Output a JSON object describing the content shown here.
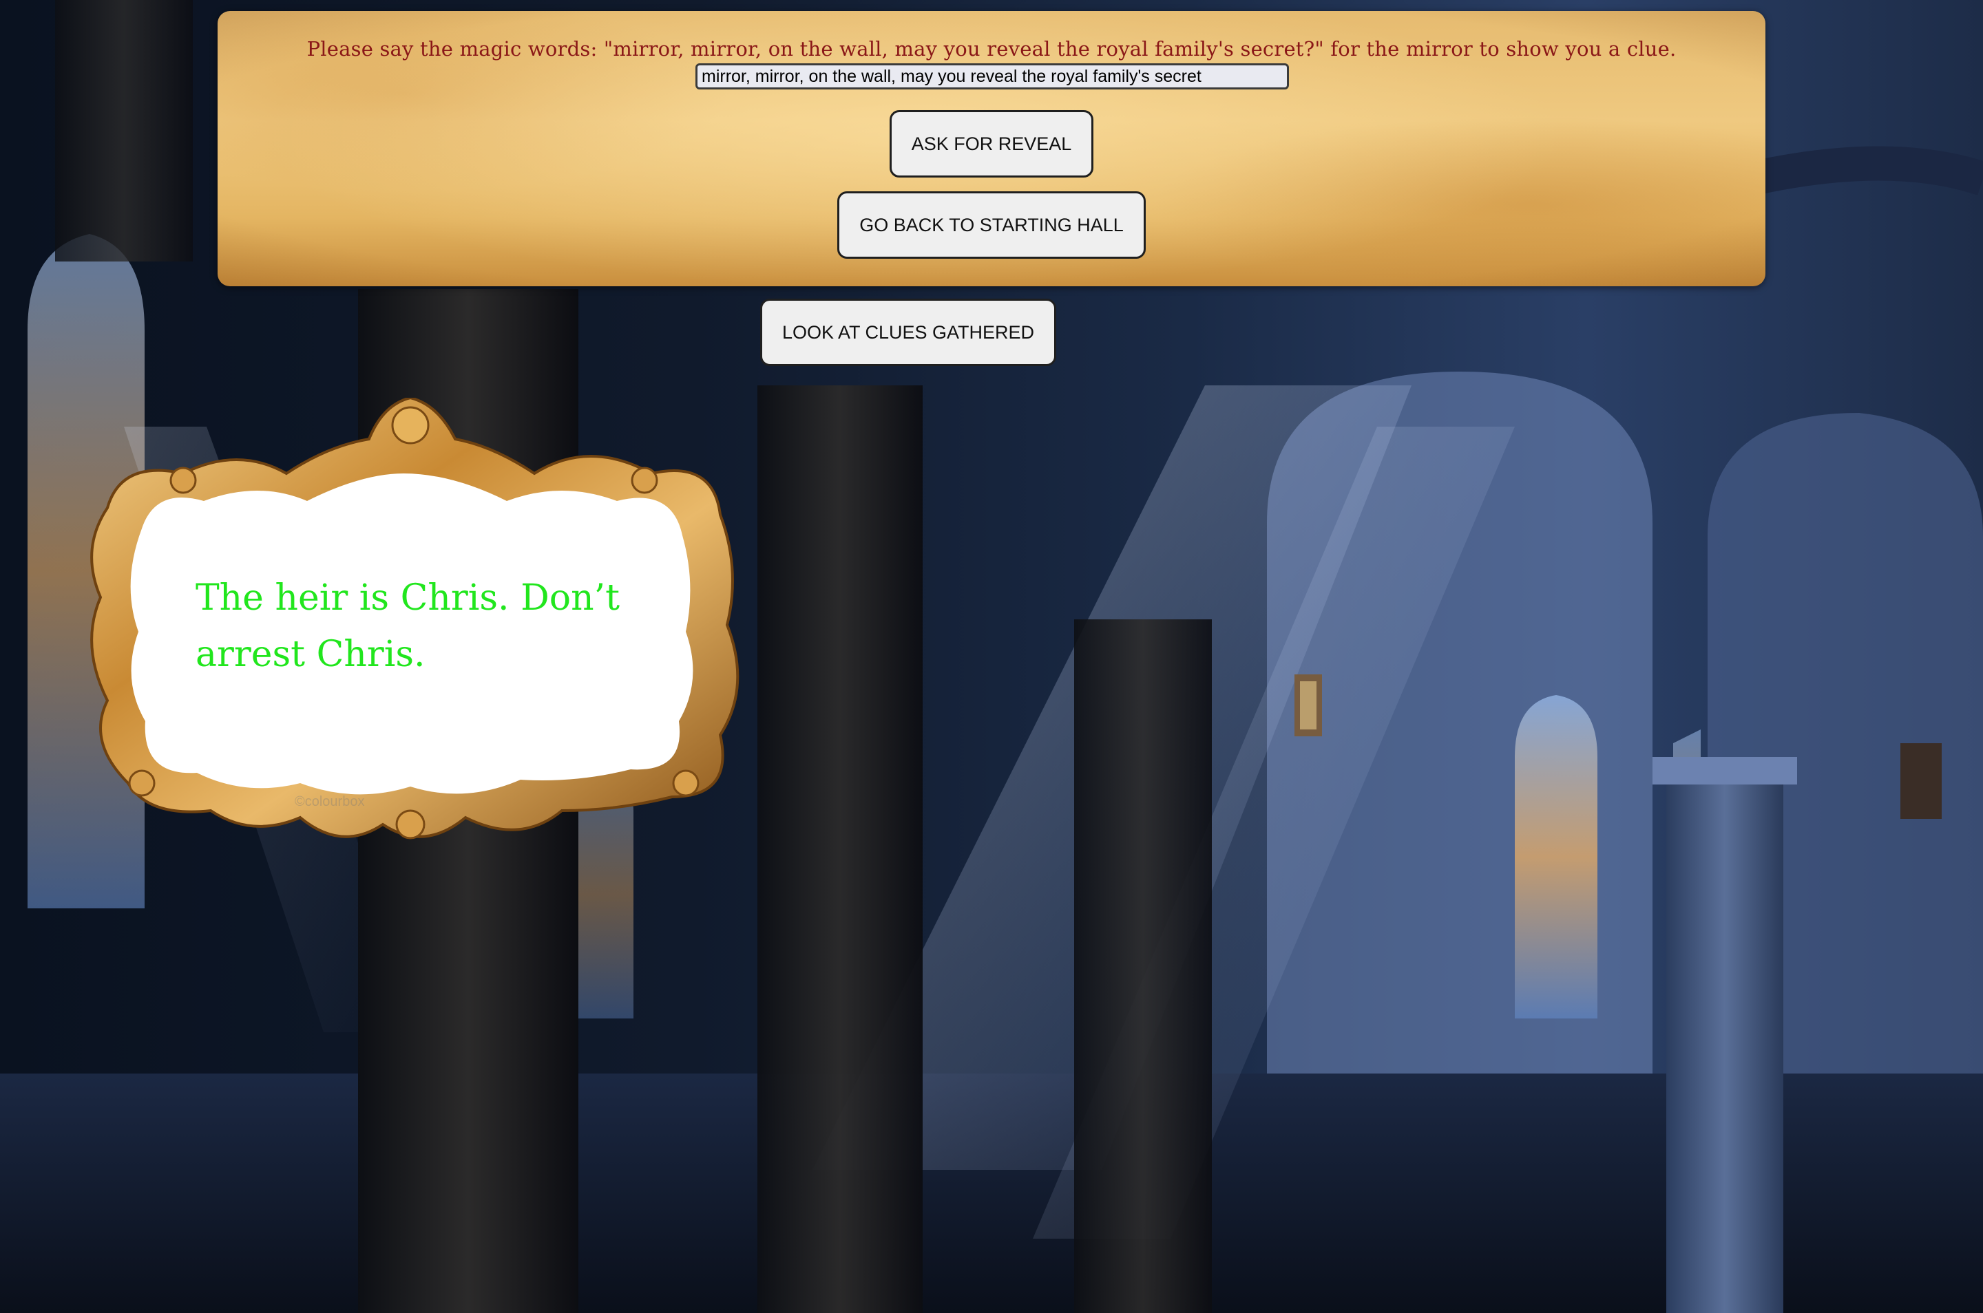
{
  "prompt": {
    "instruction": "Please say the magic words: \"mirror, mirror, on the wall, may you reveal the royal family's secret?\" for the mirror to show you a clue.",
    "input_value": "mirror, mirror, on the wall, may you reveal the royal family's secret"
  },
  "buttons": {
    "reveal": "ASK FOR REVEAL",
    "back": "GO BACK TO STARTING HALL",
    "clues": "LOOK AT CLUES GATHERED"
  },
  "mirror": {
    "clue": "The heir is Chris. Don’t arrest Chris.",
    "clue_color": "#21e61d",
    "watermark": "©colourbox"
  },
  "colors": {
    "instruction": "#8a1717",
    "parchment": "#efc980",
    "frame_gold": "#c98a34"
  }
}
